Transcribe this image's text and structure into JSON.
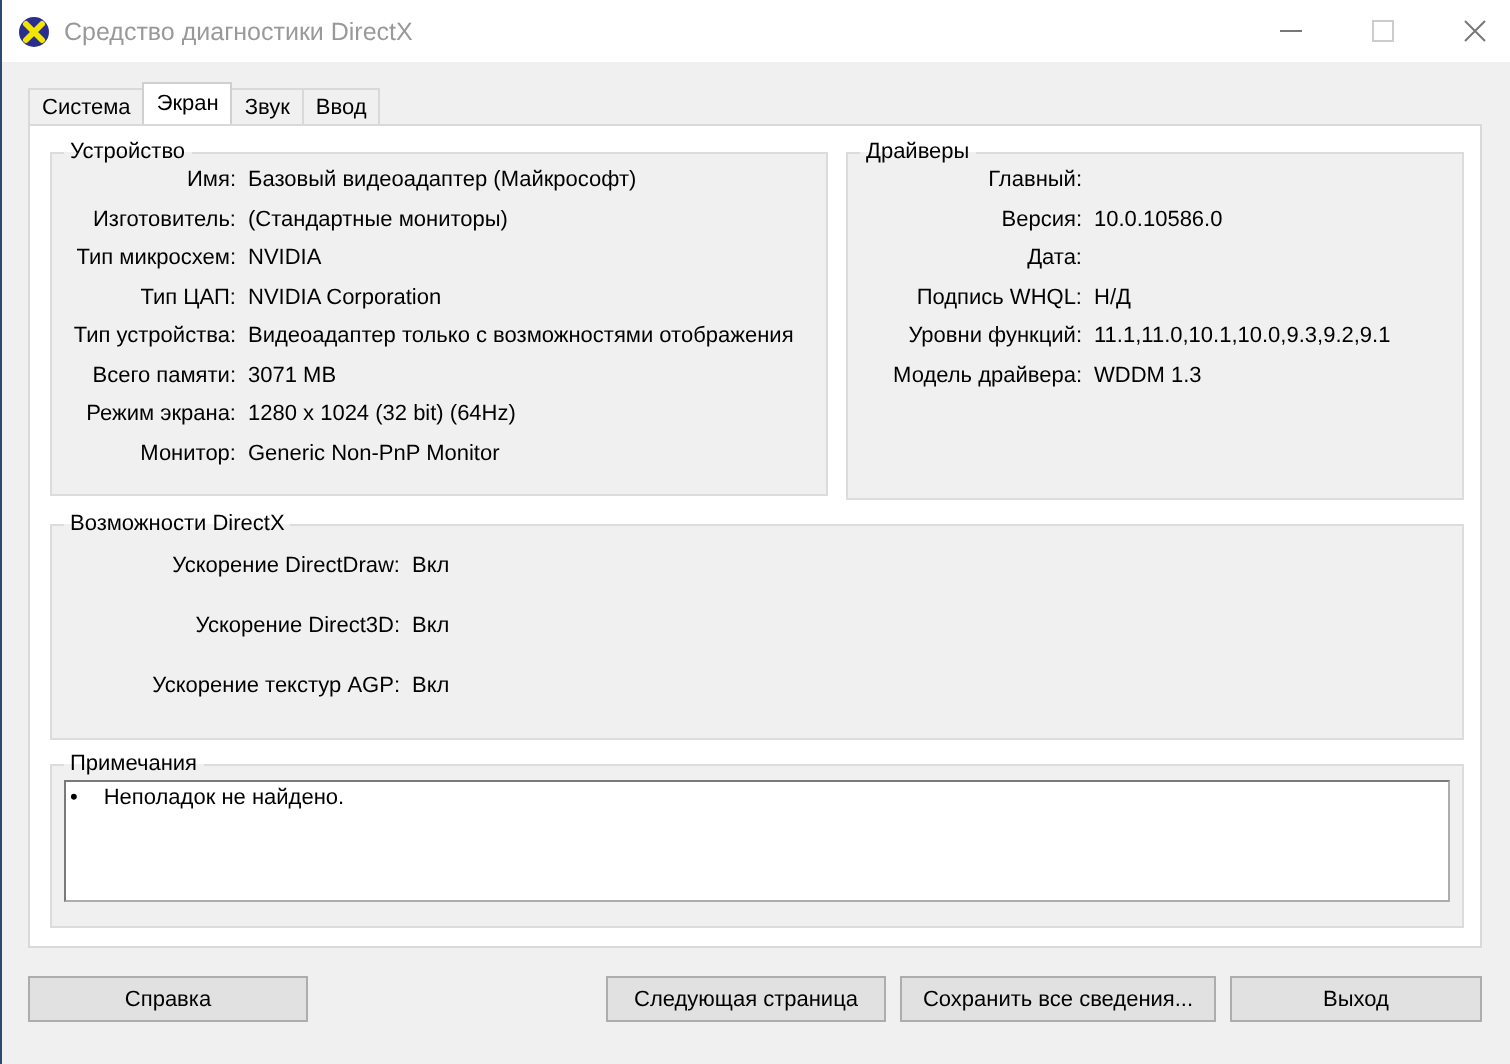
{
  "window": {
    "title": "Средство диагностики DirectX"
  },
  "tabs": [
    {
      "label": "Система",
      "selected": false
    },
    {
      "label": "Экран",
      "selected": true
    },
    {
      "label": "Звук",
      "selected": false
    },
    {
      "label": "Ввод",
      "selected": false
    }
  ],
  "device": {
    "title": "Устройство",
    "rows": [
      {
        "label": "Имя:",
        "value": "Базовый видеоадаптер (Майкрософт)"
      },
      {
        "label": "Изготовитель:",
        "value": "(Стандартные мониторы)"
      },
      {
        "label": "Тип микросхем:",
        "value": "NVIDIA"
      },
      {
        "label": "Тип ЦАП:",
        "value": "NVIDIA Corporation"
      },
      {
        "label": "Тип устройства:",
        "value": "Видеоадаптер только с возможностями отображения"
      },
      {
        "label": "Всего памяти:",
        "value": "3071 MB"
      },
      {
        "label": "Режим экрана:",
        "value": "1280 x 1024 (32 bit) (64Hz)"
      },
      {
        "label": "Монитор:",
        "value": "Generic Non-PnP Monitor"
      }
    ]
  },
  "drivers": {
    "title": "Драйверы",
    "rows": [
      {
        "label": "Главный:"
      },
      {
        "label": "Версия:",
        "value": "10.0.10586.0"
      },
      {
        "label": "Дата:"
      },
      {
        "label": "Подпись WHQL:",
        "value": "Н/Д"
      },
      {
        "label": "Уровни функций:",
        "value": "11.1,11.0,10.1,10.0,9.3,9.2,9.1"
      },
      {
        "label": "Модель драйвера:",
        "value": "WDDM 1.3"
      }
    ]
  },
  "directx_features": {
    "title": "Возможности DirectX",
    "rows": [
      {
        "label": "Ускорение DirectDraw:",
        "value": "Вкл"
      },
      {
        "label": "Ускорение Direct3D:",
        "value": "Вкл"
      },
      {
        "label": "Ускорение текстур AGP:",
        "value": "Вкл"
      }
    ]
  },
  "notes": {
    "title": "Примечания",
    "items": [
      {
        "bullet": "•",
        "text": "Неполадок не найдено."
      }
    ]
  },
  "buttons": [
    "Справка",
    "Следующая страница",
    "Сохранить все сведения...",
    "Выход"
  ]
}
